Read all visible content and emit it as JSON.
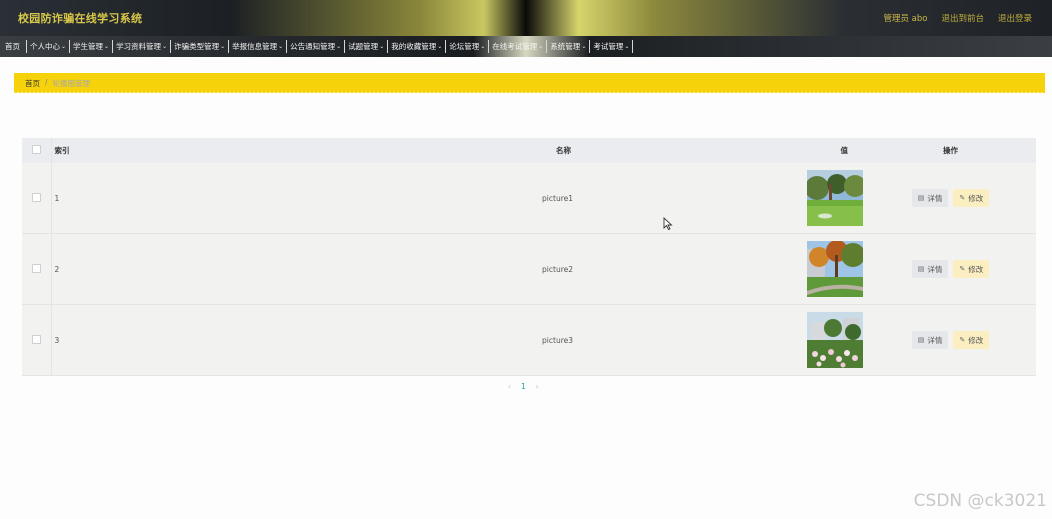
{
  "header": {
    "title": "校园防诈骗在线学习系统",
    "user": "管理员 abo",
    "back_to_front": "退出到前台",
    "logout": "退出登录"
  },
  "nav": {
    "items": [
      {
        "label": "首页",
        "dropdown": false
      },
      {
        "label": "个人中心",
        "dropdown": true
      },
      {
        "label": "学生管理",
        "dropdown": true
      },
      {
        "label": "学习资料管理",
        "dropdown": true
      },
      {
        "label": "诈骗类型管理",
        "dropdown": true
      },
      {
        "label": "举报信息管理",
        "dropdown": true
      },
      {
        "label": "公告通知管理",
        "dropdown": true
      },
      {
        "label": "试题管理",
        "dropdown": true
      },
      {
        "label": "我的收藏管理",
        "dropdown": true
      },
      {
        "label": "论坛管理",
        "dropdown": true
      },
      {
        "label": "在线考试管理",
        "dropdown": true
      },
      {
        "label": "系统管理",
        "dropdown": true
      },
      {
        "label": "考试管理",
        "dropdown": true
      }
    ]
  },
  "breadcrumb": {
    "home": "首页",
    "separator": "/",
    "current": "轮播图管理"
  },
  "table": {
    "columns": {
      "index": "索引",
      "name": "名称",
      "value": "值",
      "actions": "操作"
    },
    "rows": [
      {
        "index": "1",
        "name": "picture1",
        "thumb": "park-lawn"
      },
      {
        "index": "2",
        "name": "picture2",
        "thumb": "autumn-path"
      },
      {
        "index": "3",
        "name": "picture3",
        "thumb": "flower-garden"
      }
    ],
    "detail_label": "详情",
    "edit_label": "修改"
  },
  "pagination": {
    "prev": "‹",
    "page": "1",
    "next": "›"
  },
  "watermark": "CSDN @ck3021",
  "colors": {
    "accent": "#f6d20b",
    "title": "#d9c84a",
    "page_active": "#1aa3a3"
  }
}
